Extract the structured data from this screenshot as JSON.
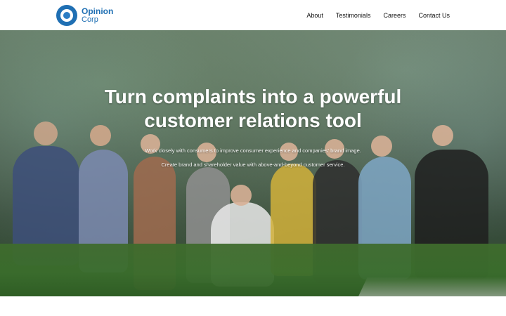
{
  "brand": {
    "name_line1": "Opinion",
    "name_line2": "Corp",
    "logo_icon": "opinion-corp-logo-mark"
  },
  "nav": {
    "items": [
      "About",
      "Testimonials",
      "Careers",
      "Contact Us"
    ]
  },
  "hero": {
    "title": "Turn complaints into a powerful customer relations tool",
    "desc_line1": "Work closely with consumers to improve consumer experience and companies' brand image.",
    "desc_line2": "Create brand and shareholder value with above-and-beyond customer service."
  },
  "colors": {
    "brand_blue": "#1f6fb3",
    "header_bg": "#ffffff",
    "hero_text": "#ffffff"
  }
}
